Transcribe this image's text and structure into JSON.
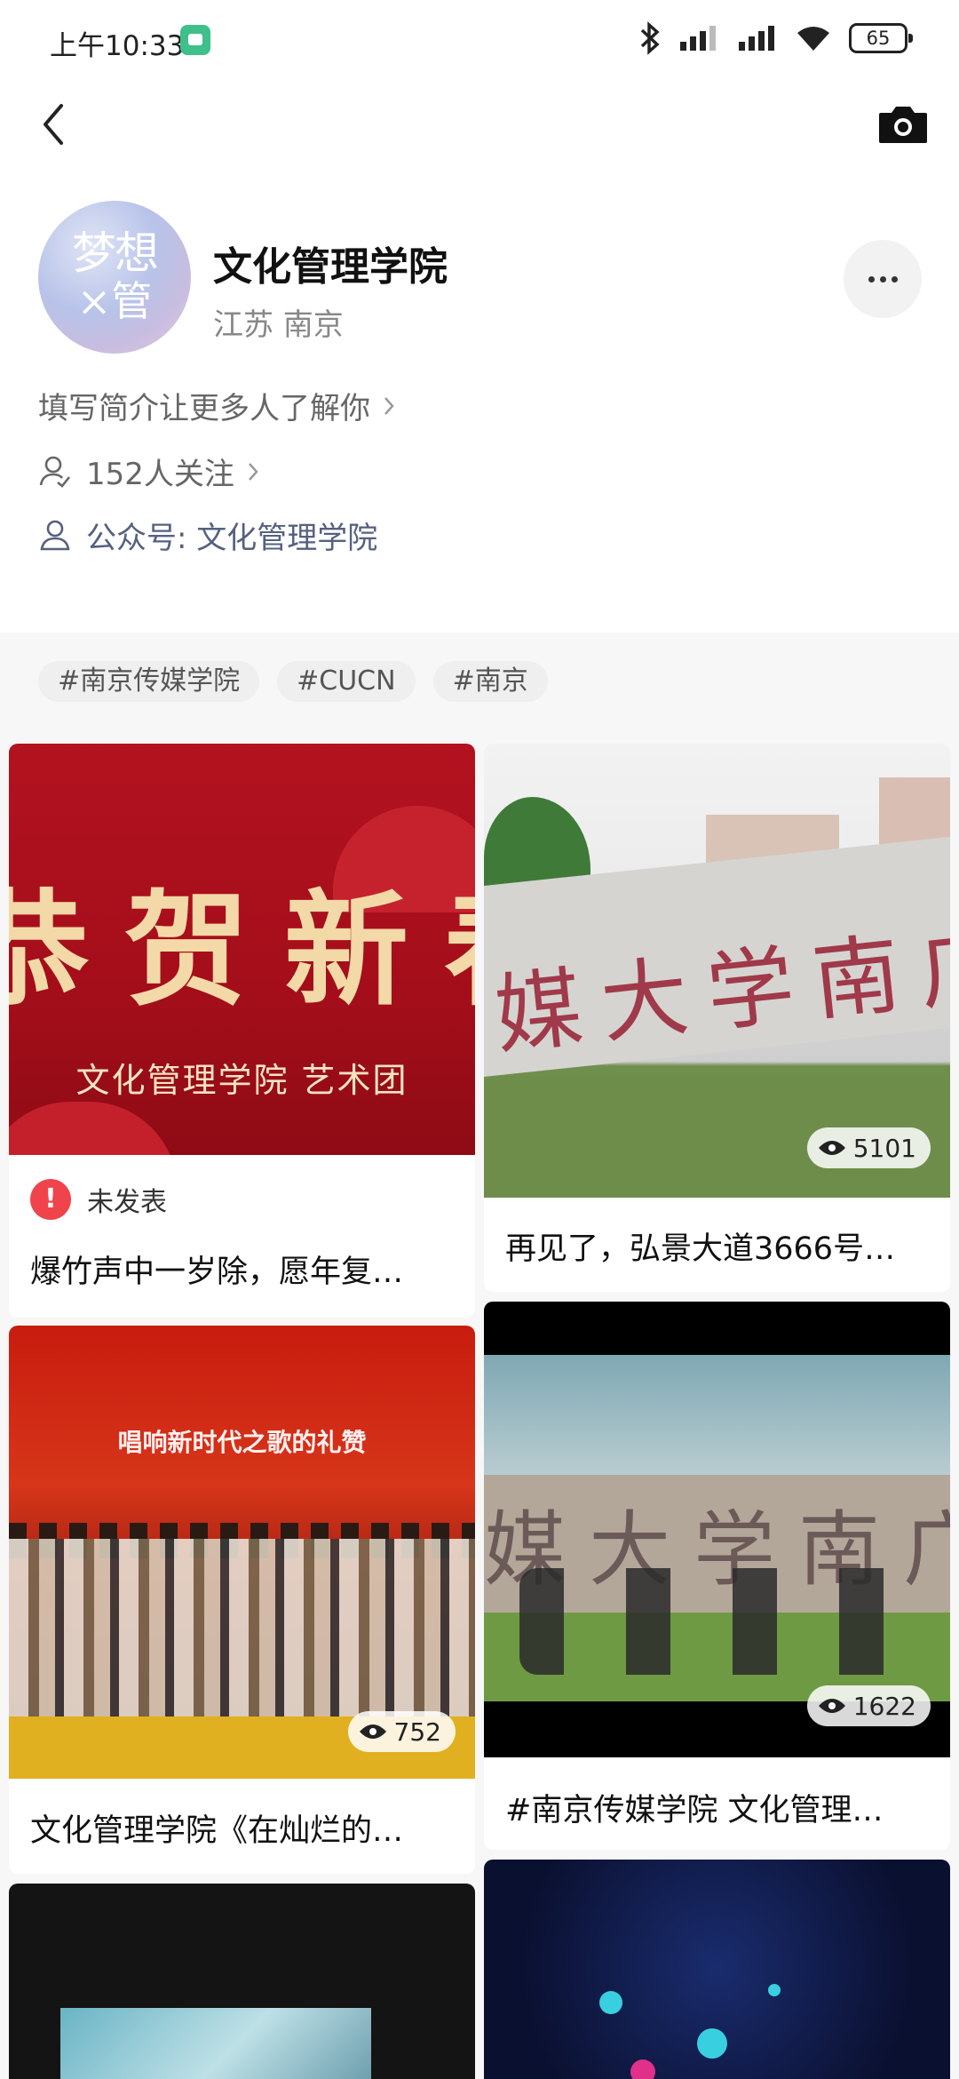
{
  "status_bar": {
    "time": "上午10:33",
    "battery": "65"
  },
  "profile": {
    "avatar_text_line1": "梦想",
    "avatar_text_line2": "×管",
    "name": "文化管理学院",
    "location": "江苏 南京",
    "intro_prompt": "填写简介让更多人了解你",
    "followers": "152人关注",
    "official_account": "公众号: 文化管理学院"
  },
  "tags": [
    "#南京传媒学院",
    "#CUCN",
    "#南京"
  ],
  "feed": {
    "card1": {
      "thumb_big_text": "恭贺新春",
      "thumb_subtitle": "文化管理学院  艺术团",
      "status": "未发表",
      "title": "爆竹声中一岁除，愿年复…"
    },
    "card2": {
      "thumb_script": "媒大学南广学",
      "views": "5101",
      "title": "再见了，弘景大道3666号…"
    },
    "card3": {
      "thumb_title": "唱响新时代之歌的礼赞",
      "views": "752",
      "title": "文化管理学院《在灿烂的…"
    },
    "card4": {
      "thumb_script": "媒大学南广",
      "views": "1622",
      "title": "#南京传媒学院 文化管理…"
    }
  },
  "colors": {
    "accent_link": "#56607f",
    "alert_red": "#f1434b",
    "banner_red": "#b3121f"
  },
  "icons": {
    "back": "chevron-left-icon",
    "camera": "camera-icon",
    "more": "more-icon",
    "followers": "user-icon",
    "account": "person-icon",
    "views": "eye-icon",
    "unpublished": "alert-icon"
  }
}
